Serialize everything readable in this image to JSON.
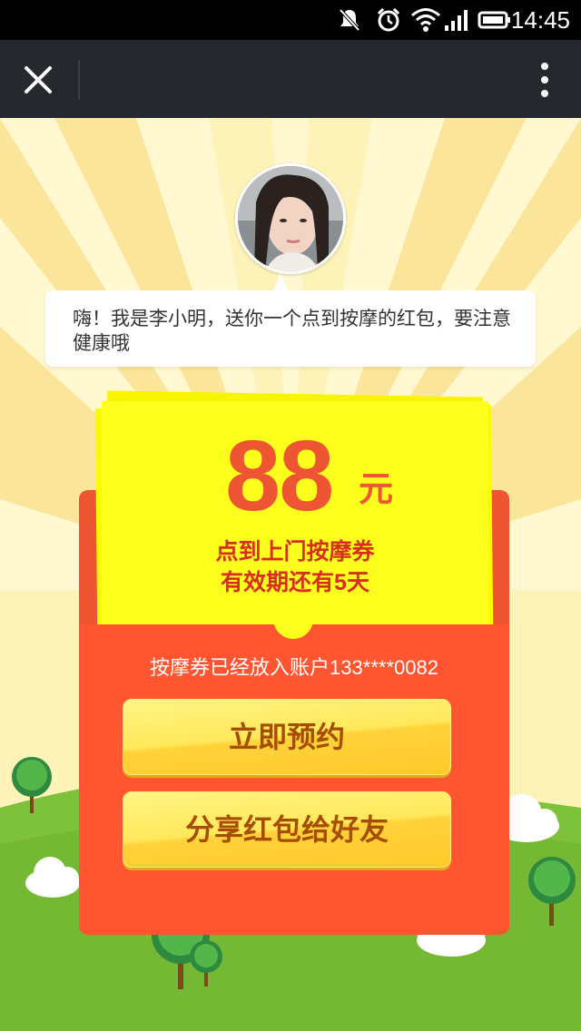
{
  "status_bar": {
    "time": "14:45",
    "icons": [
      "mute-icon",
      "alarm-icon",
      "wifi-icon",
      "signal-icon",
      "battery-icon"
    ]
  },
  "app_bar": {
    "close_icon": "close-icon",
    "menu_icon": "more-vertical-icon"
  },
  "greeting": {
    "text": "嗨！我是李小明，送你一个点到按摩的红包，要注意健康哦"
  },
  "coupon": {
    "amount": "88",
    "unit": "元",
    "name": "点到上门按摩券",
    "validity": "有效期还有5天"
  },
  "account_notice": "按摩券已经放入账户133****0082",
  "buttons": {
    "book": "立即预约",
    "share": "分享红包给好友"
  },
  "colors": {
    "background": "#fdf2b8",
    "envelope": "#ff5530",
    "coupon": "#ffff1e",
    "button_text": "#a84d00",
    "grass": "#7ec13a"
  }
}
